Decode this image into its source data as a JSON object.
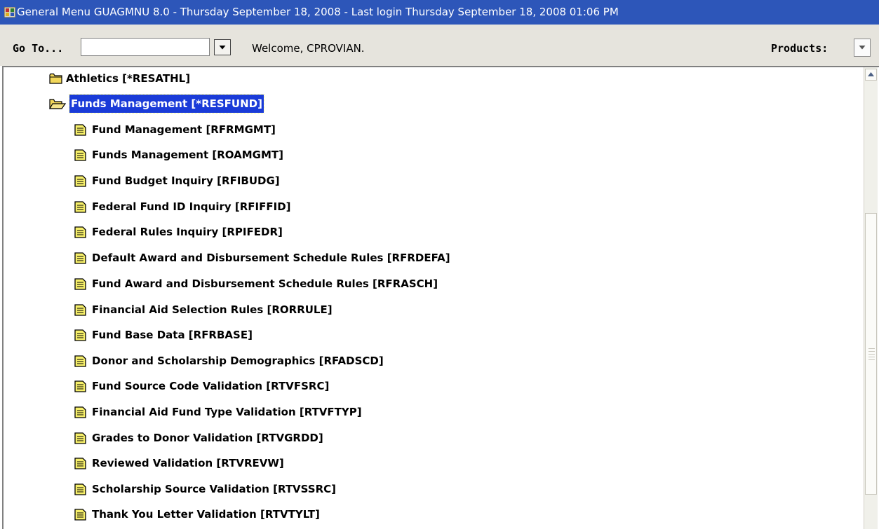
{
  "window": {
    "title": "General Menu  GUAGMNU  8.0 - Thursday September 18, 2008 - Last login Thursday September 18, 2008 01:06 PM"
  },
  "toolbar": {
    "goto_label": "Go To...",
    "goto_value": "",
    "welcome": "Welcome, CPROVIAN.",
    "products_label": "Products:"
  },
  "tree": {
    "folders": [
      {
        "label": "Athletics [*RESATHL]",
        "state": "closed"
      },
      {
        "label": "Funds Management [*RESFUND]",
        "state": "open",
        "selected": true
      }
    ],
    "items": [
      {
        "label": "Fund Management [RFRMGMT]"
      },
      {
        "label": "Funds Management [ROAMGMT]"
      },
      {
        "label": "Fund Budget Inquiry [RFIBUDG]"
      },
      {
        "label": "Federal Fund ID Inquiry [RFIFFID]"
      },
      {
        "label": "Federal Rules Inquiry [RPIFEDR]"
      },
      {
        "label": "Default Award and Disbursement Schedule Rules [RFRDEFA]"
      },
      {
        "label": "Fund Award and Disbursement Schedule Rules [RFRASCH]"
      },
      {
        "label": "Financial Aid Selection Rules [RORRULE]"
      },
      {
        "label": "Fund Base Data [RFRBASE]"
      },
      {
        "label": "Donor and Scholarship Demographics [RFADSCD]"
      },
      {
        "label": "Fund Source Code Validation [RTVFSRC]"
      },
      {
        "label": "Financial Aid Fund Type Validation [RTVFTYP]"
      },
      {
        "label": "Grades to Donor Validation [RTVGRDD]"
      },
      {
        "label": "Reviewed Validation [RTVREVW]"
      },
      {
        "label": "Scholarship Source Validation [RTVSSRC]"
      },
      {
        "label": "Thank You Letter Validation [RTVTYLT]"
      }
    ]
  },
  "colors": {
    "titlebar": "#2d56b9",
    "selection": "#1a3bd8",
    "toolbar": "#e6e4dd",
    "folder": "#f2d75a",
    "document": "#f7f06a"
  }
}
